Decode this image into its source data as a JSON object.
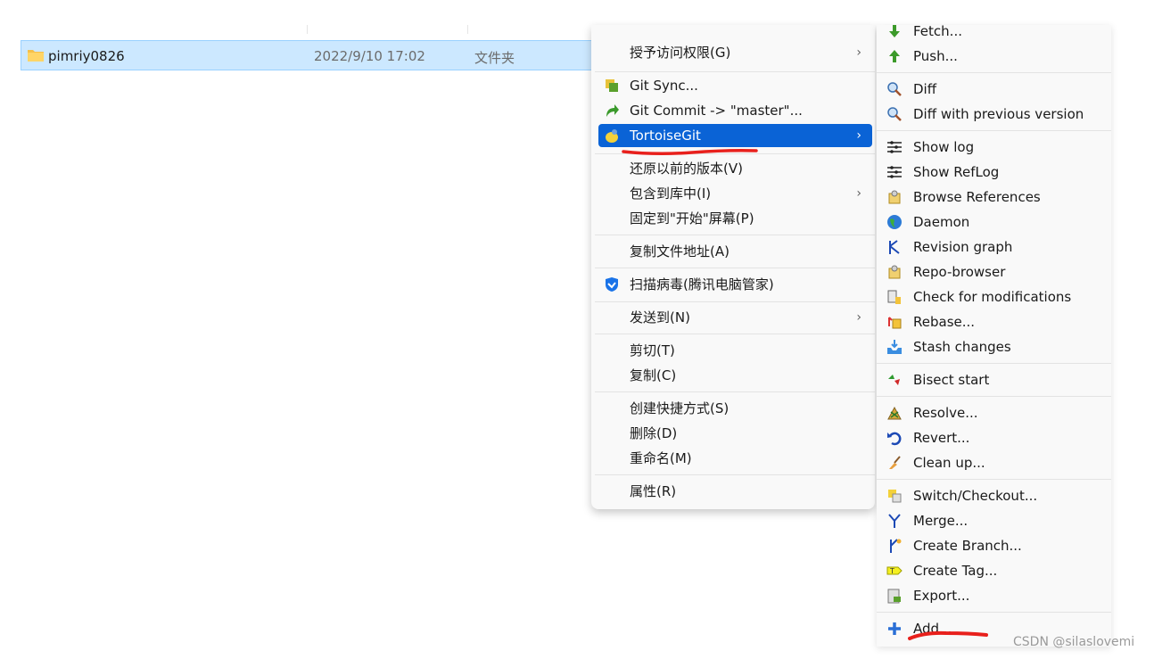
{
  "file": {
    "name": "pimriy0826",
    "date": "2022/9/10 17:02",
    "type": "文件夹"
  },
  "context_menu": {
    "items": [
      {
        "label": "授予访问权限(G)",
        "icon": "none",
        "submenu": true
      },
      {
        "label": "Git Sync...",
        "icon": "git-sync-icon",
        "submenu": false
      },
      {
        "label": "Git Commit -> \"master\"...",
        "icon": "git-commit-icon",
        "submenu": false
      },
      {
        "label": "TortoiseGit",
        "icon": "tortoisegit-icon",
        "submenu": true,
        "highlighted": true
      },
      {
        "label": "还原以前的版本(V)",
        "icon": "none",
        "submenu": false
      },
      {
        "label": "包含到库中(I)",
        "icon": "none",
        "submenu": true
      },
      {
        "label": "固定到\"开始\"屏幕(P)",
        "icon": "none",
        "submenu": false
      },
      {
        "label": "复制文件地址(A)",
        "icon": "none",
        "submenu": false
      },
      {
        "label": "扫描病毒(腾讯电脑管家)",
        "icon": "tencent-shield-icon",
        "submenu": false
      },
      {
        "label": "发送到(N)",
        "icon": "none",
        "submenu": true
      },
      {
        "label": "剪切(T)",
        "icon": "none",
        "submenu": false
      },
      {
        "label": "复制(C)",
        "icon": "none",
        "submenu": false
      },
      {
        "label": "创建快捷方式(S)",
        "icon": "none",
        "submenu": false
      },
      {
        "label": "删除(D)",
        "icon": "none",
        "submenu": false
      },
      {
        "label": "重命名(M)",
        "icon": "none",
        "submenu": false
      },
      {
        "label": "属性(R)",
        "icon": "none",
        "submenu": false
      }
    ]
  },
  "tortoisegit_submenu": {
    "items": [
      {
        "label": "Fetch...",
        "icon": "fetch-icon"
      },
      {
        "label": "Push...",
        "icon": "push-icon"
      },
      {
        "label": "Diff",
        "icon": "diff-icon"
      },
      {
        "label": "Diff with previous version",
        "icon": "diff-previous-icon"
      },
      {
        "label": "Show log",
        "icon": "show-log-icon"
      },
      {
        "label": "Show RefLog",
        "icon": "show-reflog-icon"
      },
      {
        "label": "Browse References",
        "icon": "browse-references-icon"
      },
      {
        "label": "Daemon",
        "icon": "daemon-globe-icon"
      },
      {
        "label": "Revision graph",
        "icon": "revision-graph-icon"
      },
      {
        "label": "Repo-browser",
        "icon": "repo-browser-icon"
      },
      {
        "label": "Check for modifications",
        "icon": "check-modifications-icon"
      },
      {
        "label": "Rebase...",
        "icon": "rebase-icon"
      },
      {
        "label": "Stash changes",
        "icon": "stash-icon"
      },
      {
        "label": "Bisect start",
        "icon": "bisect-icon"
      },
      {
        "label": "Resolve...",
        "icon": "resolve-icon"
      },
      {
        "label": "Revert...",
        "icon": "revert-icon"
      },
      {
        "label": "Clean up...",
        "icon": "cleanup-broom-icon"
      },
      {
        "label": "Switch/Checkout...",
        "icon": "switch-checkout-icon"
      },
      {
        "label": "Merge...",
        "icon": "merge-icon"
      },
      {
        "label": "Create Branch...",
        "icon": "create-branch-icon"
      },
      {
        "label": "Create Tag...",
        "icon": "create-tag-icon"
      },
      {
        "label": "Export...",
        "icon": "export-icon"
      },
      {
        "label": "Add...",
        "icon": "add-plus-icon"
      }
    ]
  },
  "colors": {
    "highlight": "#0a63d6",
    "selection": "#cce8ff",
    "annotation": "#e8201c"
  },
  "watermark": "CSDN @silaslovemi"
}
